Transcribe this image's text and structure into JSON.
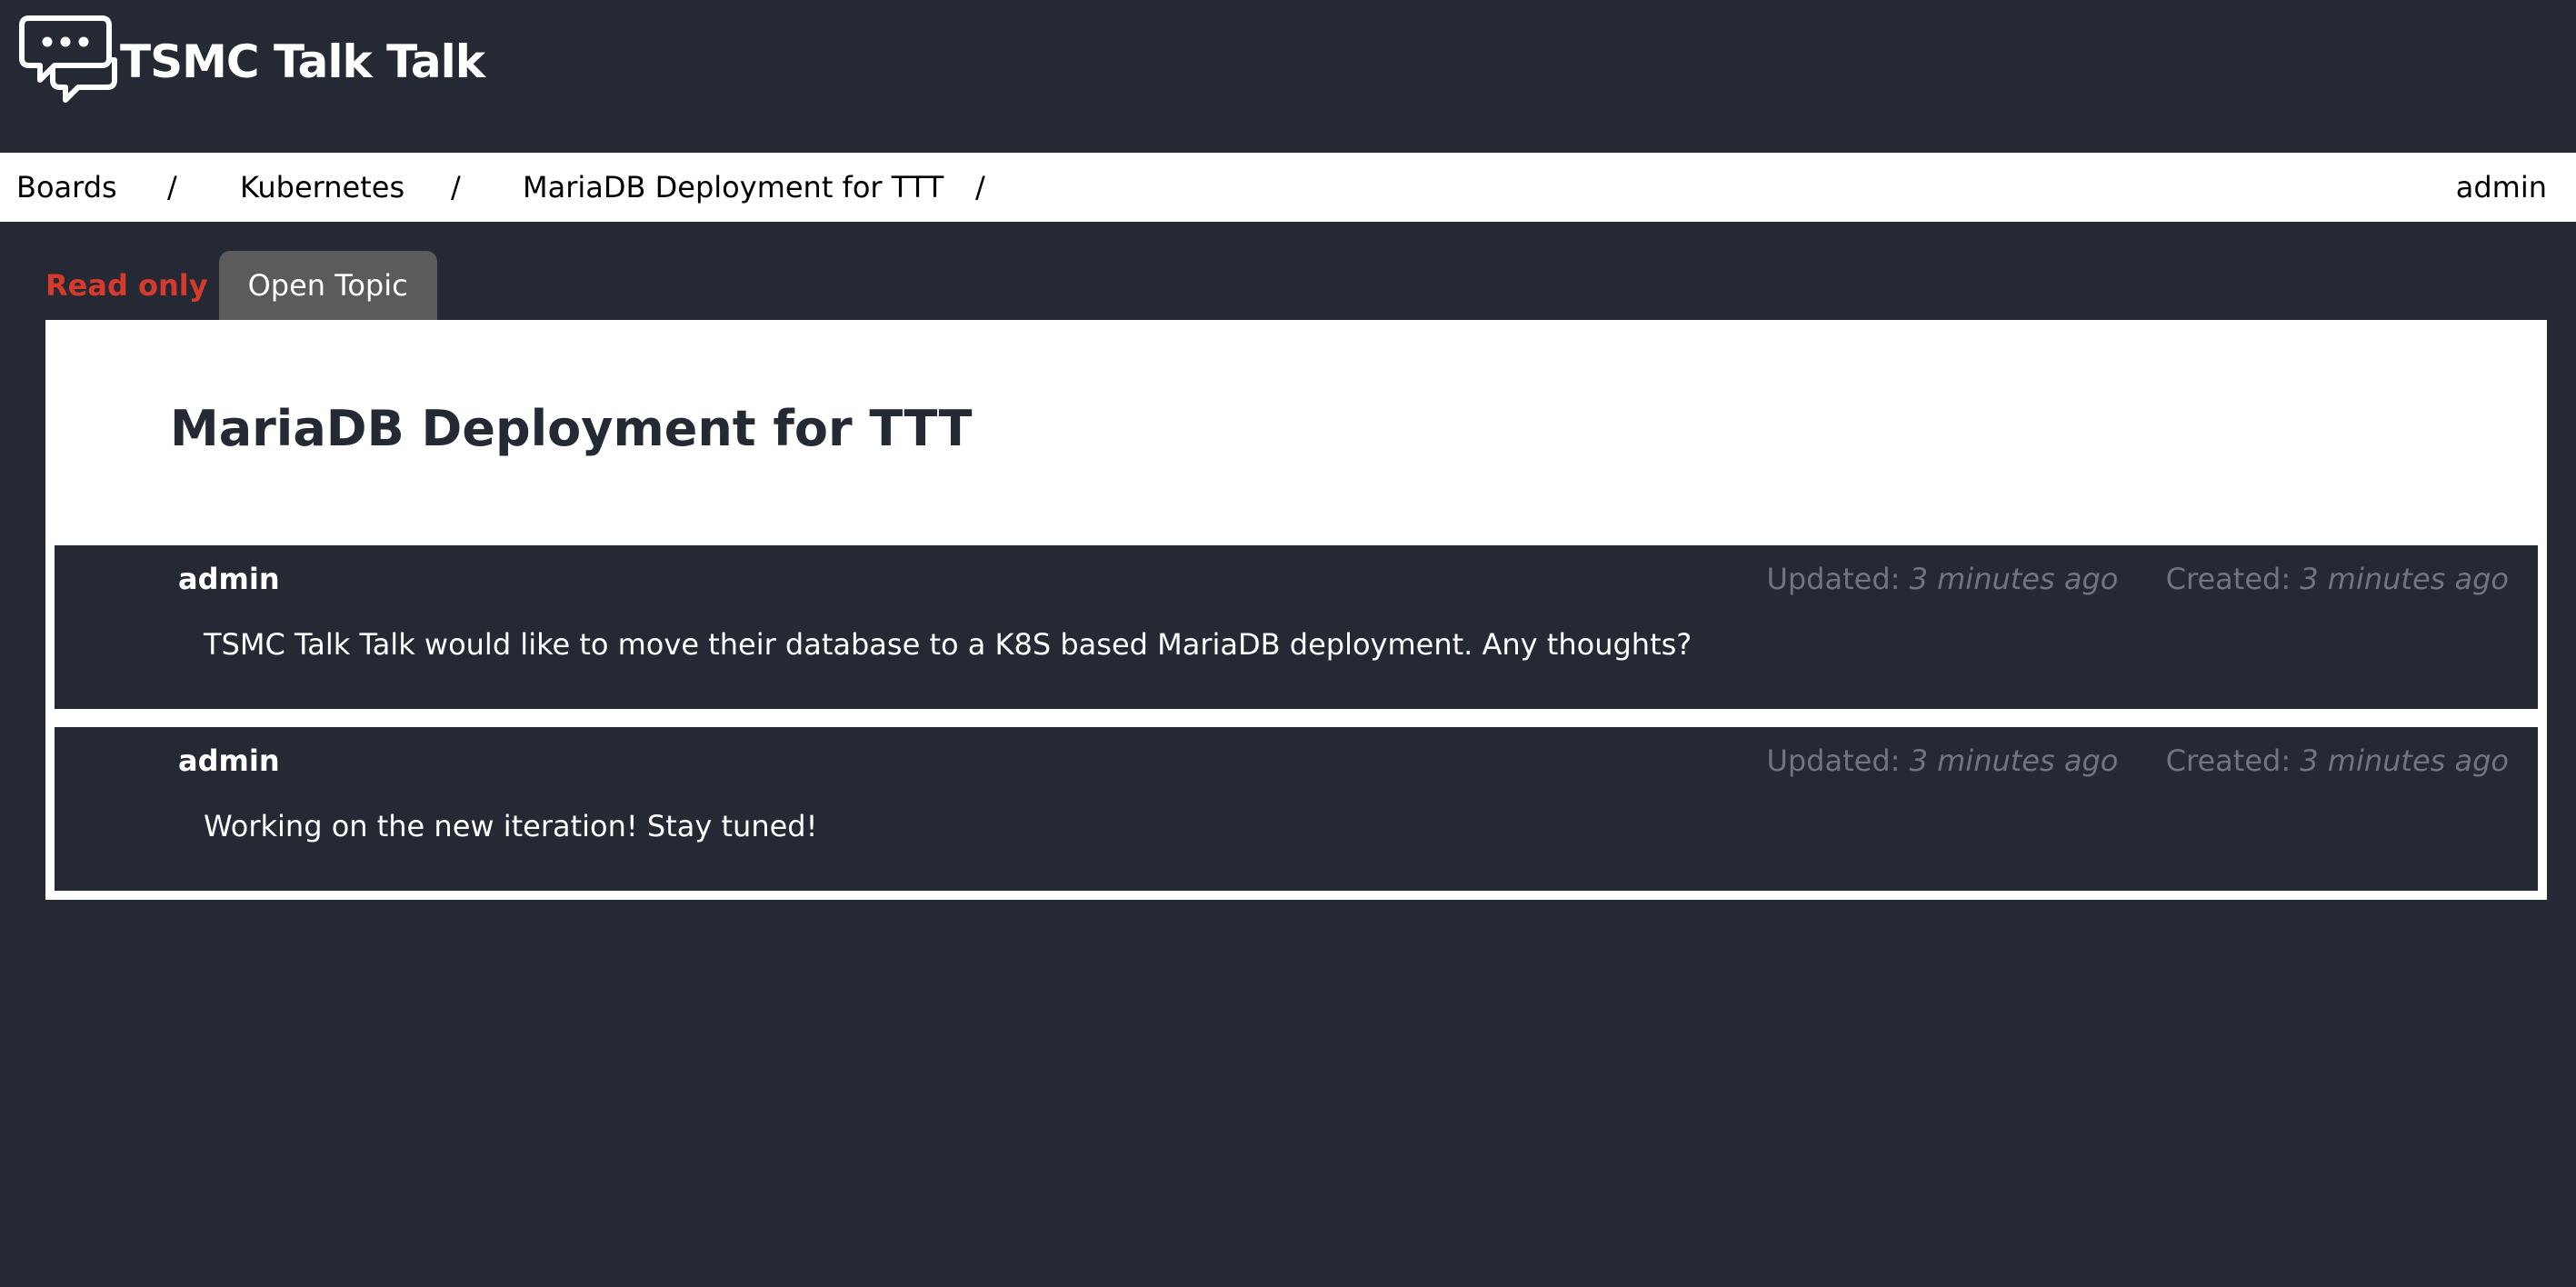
{
  "header": {
    "app_name": "TSMC Talk Talk",
    "logo_icon": "chat-bubble-icon"
  },
  "breadcrumb": {
    "items": [
      {
        "label": "Boards"
      },
      {
        "label": "Kubernetes"
      },
      {
        "label": "MariaDB Deployment for TTT"
      }
    ],
    "separator": "/"
  },
  "user": {
    "name": "admin"
  },
  "topic": {
    "status": "Read only",
    "open_button_label": "Open Topic",
    "title": "MariaDB Deployment for TTT",
    "posts": [
      {
        "author": "admin",
        "updated_label": "Updated:",
        "updated_value": "3 minutes ago",
        "created_label": "Created:",
        "created_value": "3 minutes ago",
        "body": "TSMC Talk Talk would like to move their database to a K8S based MariaDB deployment. Any thoughts?"
      },
      {
        "author": "admin",
        "updated_label": "Updated:",
        "updated_value": "3 minutes ago",
        "created_label": "Created:",
        "created_value": "3 minutes ago",
        "body": "Working on the new iteration! Stay tuned!"
      }
    ]
  },
  "colors": {
    "background": "#242933",
    "panel": "#ffffff",
    "read_only": "#d63a2c",
    "button": "#5b5b5b",
    "meta_text": "#707580"
  }
}
